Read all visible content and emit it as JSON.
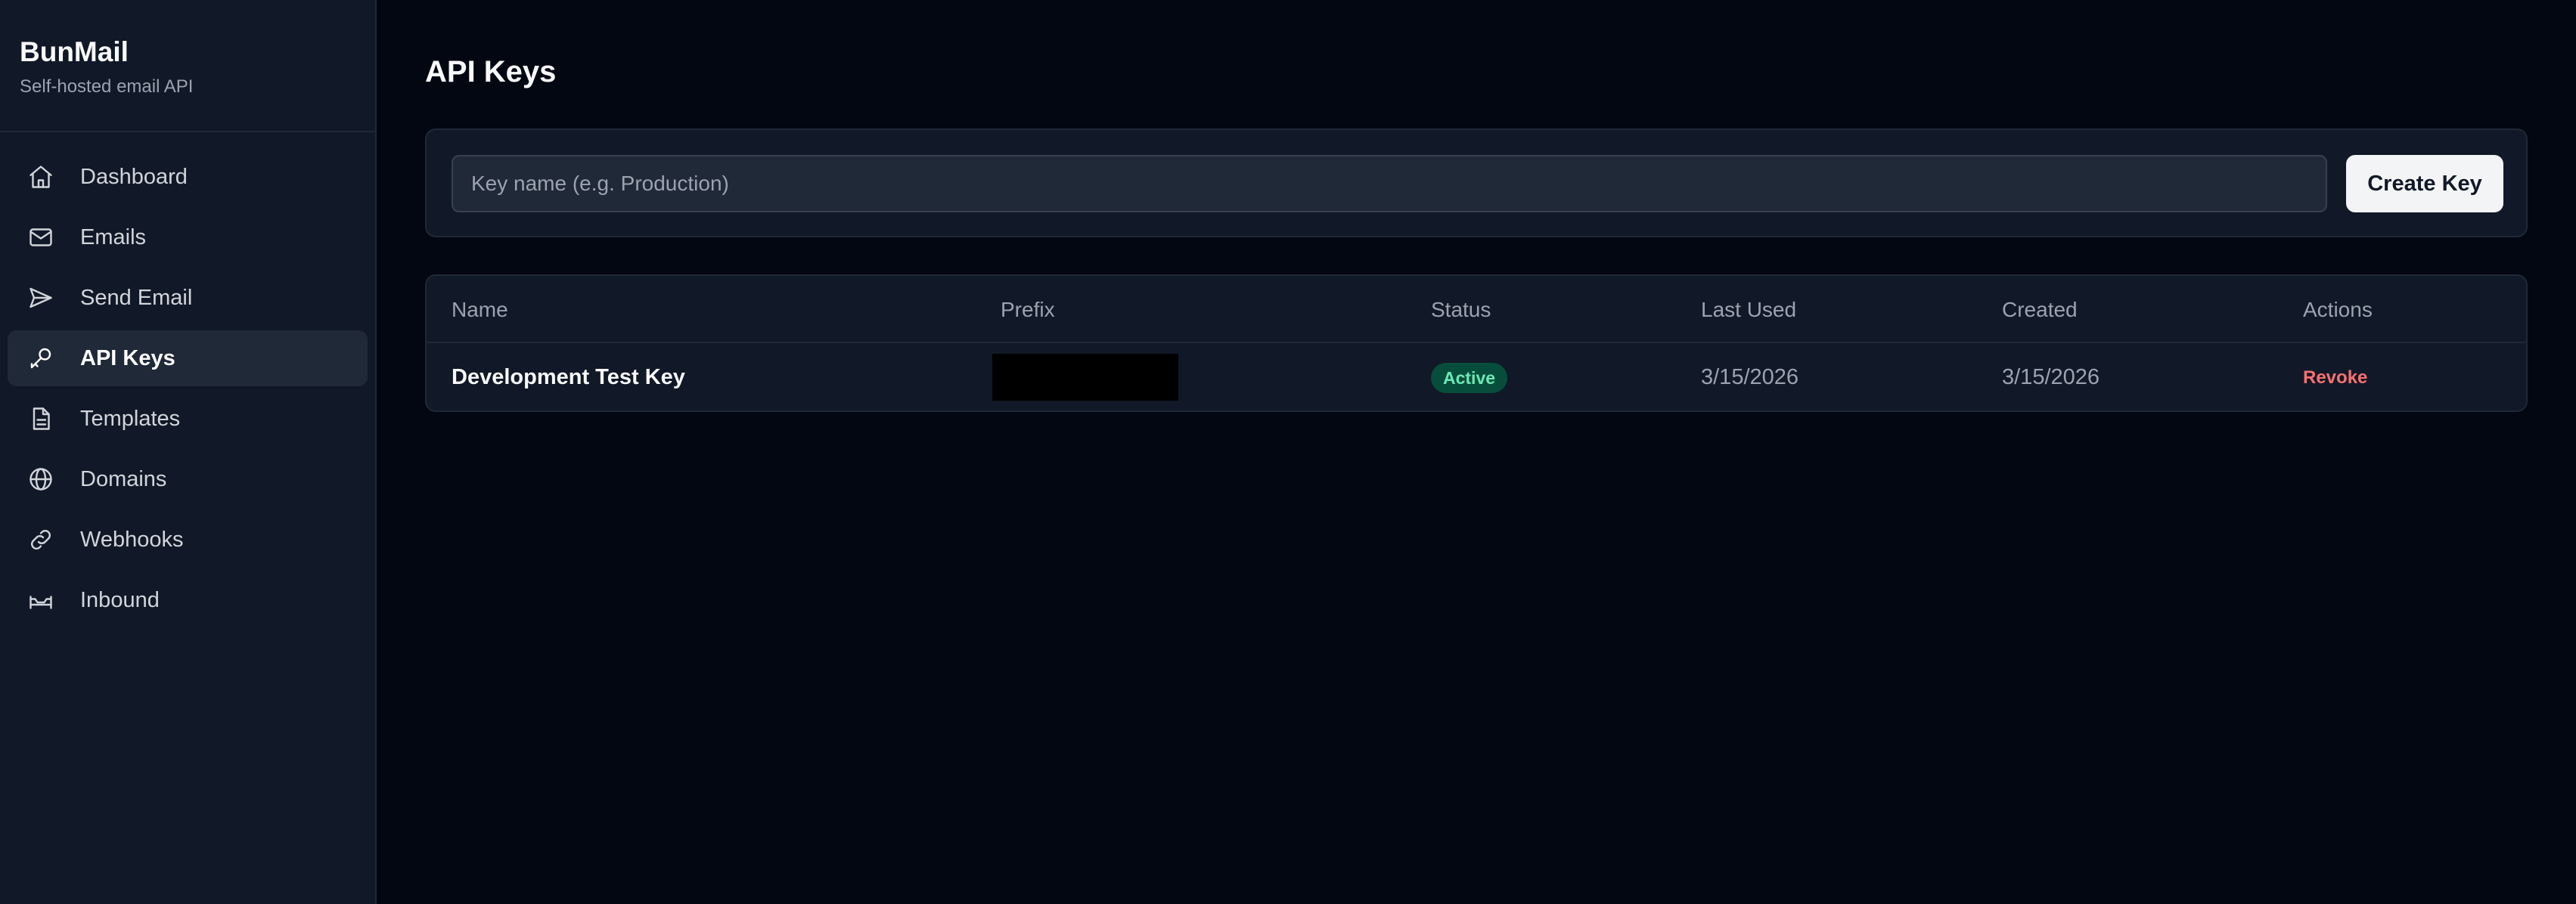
{
  "sidebar": {
    "brand_title": "BunMail",
    "brand_subtitle": "Self-hosted email API",
    "items": [
      {
        "label": "Dashboard",
        "icon": "home-icon",
        "active": false
      },
      {
        "label": "Emails",
        "icon": "mail-icon",
        "active": false
      },
      {
        "label": "Send Email",
        "icon": "send-icon",
        "active": false
      },
      {
        "label": "API Keys",
        "icon": "key-icon",
        "active": true
      },
      {
        "label": "Templates",
        "icon": "file-icon",
        "active": false
      },
      {
        "label": "Domains",
        "icon": "globe-icon",
        "active": false
      },
      {
        "label": "Webhooks",
        "icon": "link-icon",
        "active": false
      },
      {
        "label": "Inbound",
        "icon": "inbox-icon",
        "active": false
      }
    ]
  },
  "main": {
    "title": "API Keys",
    "create": {
      "placeholder": "Key name (e.g. Production)",
      "value": "",
      "button_label": "Create Key"
    },
    "table": {
      "headers": {
        "name": "Name",
        "prefix": "Prefix",
        "status": "Status",
        "last_used": "Last Used",
        "created": "Created",
        "actions": "Actions"
      },
      "rows": [
        {
          "name": "Development Test Key",
          "prefix": "",
          "status": "Active",
          "last_used": "3/15/2026",
          "created": "3/15/2026",
          "action": "Revoke"
        }
      ]
    }
  },
  "colors": {
    "background": "#030712",
    "sidebar": "#111827",
    "active_badge_bg": "#064e3b",
    "active_badge_text": "#6ee7b7",
    "danger": "#f87171"
  }
}
